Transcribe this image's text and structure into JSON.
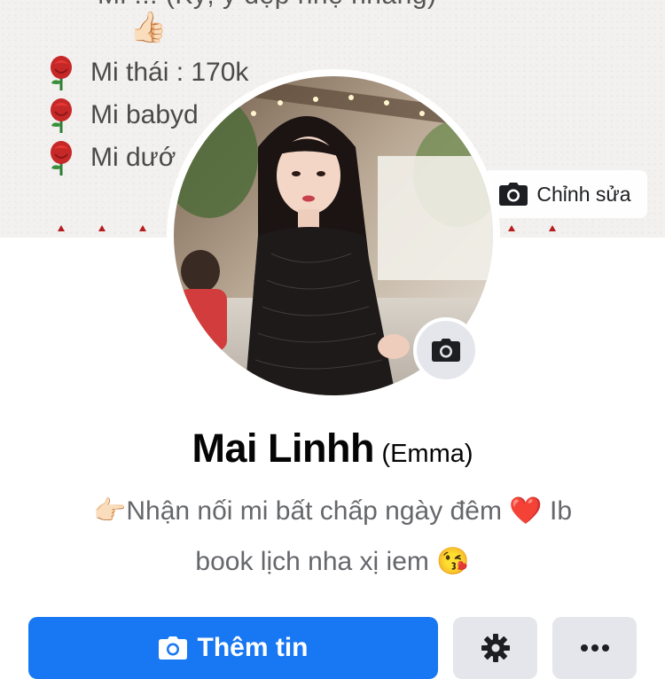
{
  "cover": {
    "top_text": "Mi ... (Kỹ, y đẹp nhẹ nhàng)",
    "thumb_emoji": "👍🏻",
    "lines": [
      "Mi thái : 170k",
      "Mi babyd",
      "Mi dướ"
    ],
    "bullet_icon": "rose-icon",
    "edit_label": "Chỉnh sửa"
  },
  "profile": {
    "name": "Mai Linhh",
    "nickname": "(Emma)",
    "bio_line1_prefix": "👉🏻",
    "bio_line1_text": "Nhận nối mi bất chấp ngày đêm",
    "bio_line1_emoji": "❤️",
    "bio_line1_suffix": "Ib",
    "bio_line2_text": "book lịch nha xị iem",
    "bio_line2_emoji": "😘"
  },
  "actions": {
    "add_story_label": "Thêm tin",
    "settings_icon": "gear-icon",
    "more_icon": "more-icon"
  },
  "colors": {
    "primary": "#1877f2",
    "button_gray": "#e4e6eb",
    "bio_text": "#65676b",
    "cover_bg": "#f2f1ef"
  }
}
